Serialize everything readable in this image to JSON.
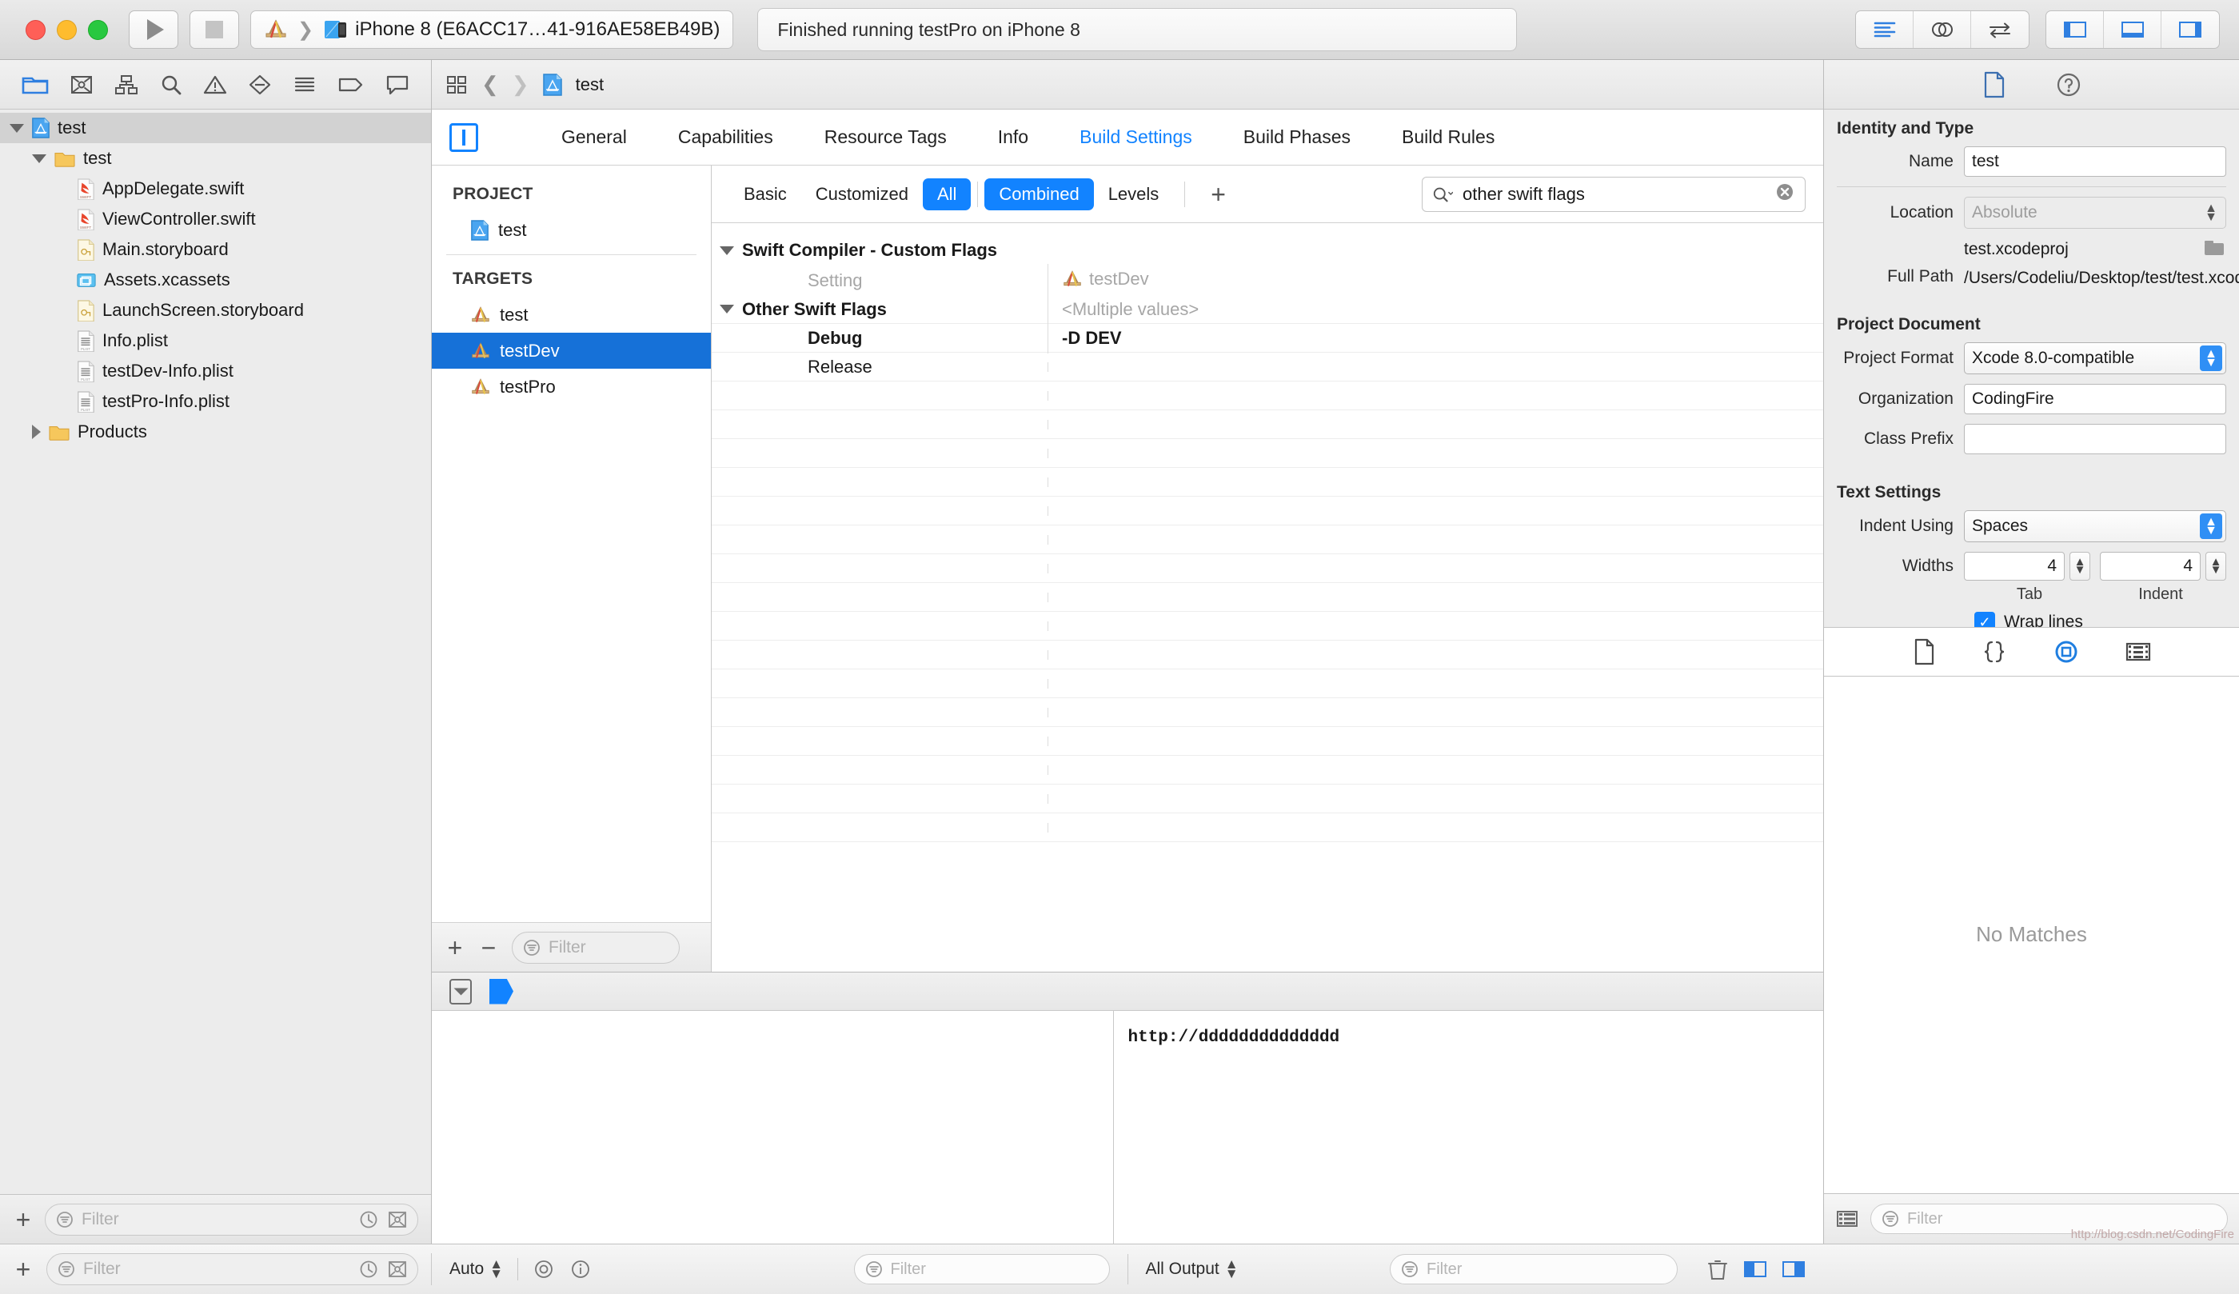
{
  "titlebar": {
    "scheme_target": "iPhone 8 (E6ACC17…41-916AE58EB49B)",
    "status": "Finished running testPro on iPhone 8",
    "run_icon": "play-icon",
    "stop_icon": "stop-icon"
  },
  "navigator": {
    "toolbar_icons": [
      "folder-icon",
      "source-control-icon",
      "symbol-icon",
      "search-icon",
      "warning-icon",
      "test-icon",
      "debug-icon",
      "breakpoint-icon",
      "report-icon"
    ],
    "tree": [
      {
        "label": "test",
        "depth": 0,
        "twisty": "down",
        "icon": "xcodeproj-icon",
        "selected": true
      },
      {
        "label": "test",
        "depth": 1,
        "twisty": "down",
        "icon": "folder-icon",
        "selected": false
      },
      {
        "label": "AppDelegate.swift",
        "depth": 2,
        "twisty": "none",
        "icon": "swift-icon",
        "selected": false
      },
      {
        "label": "ViewController.swift",
        "depth": 2,
        "twisty": "none",
        "icon": "swift-icon",
        "selected": false
      },
      {
        "label": "Main.storyboard",
        "depth": 2,
        "twisty": "none",
        "icon": "storyboard-icon",
        "selected": false
      },
      {
        "label": "Assets.xcassets",
        "depth": 2,
        "twisty": "none",
        "icon": "xcassets-icon",
        "selected": false
      },
      {
        "label": "LaunchScreen.storyboard",
        "depth": 2,
        "twisty": "none",
        "icon": "storyboard-icon",
        "selected": false
      },
      {
        "label": "Info.plist",
        "depth": 2,
        "twisty": "none",
        "icon": "plist-icon",
        "selected": false
      },
      {
        "label": "testDev-Info.plist",
        "depth": 2,
        "twisty": "none",
        "icon": "plist-icon",
        "selected": false
      },
      {
        "label": "testPro-Info.plist",
        "depth": 2,
        "twisty": "none",
        "icon": "plist-icon",
        "selected": false
      },
      {
        "label": "Products",
        "depth": 1,
        "twisty": "right",
        "icon": "folder-icon",
        "selected": false
      }
    ],
    "filter_placeholder": "Filter",
    "add_label": "+"
  },
  "jumpbar": {
    "title": "test"
  },
  "project_editor": {
    "tabs": [
      {
        "label": "General",
        "active": false
      },
      {
        "label": "Capabilities",
        "active": false
      },
      {
        "label": "Resource Tags",
        "active": false
      },
      {
        "label": "Info",
        "active": false
      },
      {
        "label": "Build Settings",
        "active": true
      },
      {
        "label": "Build Phases",
        "active": false
      },
      {
        "label": "Build Rules",
        "active": false
      }
    ],
    "project_header": "PROJECT",
    "project_items": [
      {
        "label": "test"
      }
    ],
    "targets_header": "TARGETS",
    "targets": [
      {
        "label": "test",
        "selected": false
      },
      {
        "label": "testDev",
        "selected": true
      },
      {
        "label": "testPro",
        "selected": false
      }
    ],
    "pane_add": "+",
    "pane_remove": "−",
    "pane_filter_placeholder": "Filter"
  },
  "build_settings": {
    "filters": [
      {
        "label": "Basic",
        "active": false
      },
      {
        "label": "Customized",
        "active": false
      },
      {
        "label": "All",
        "active": true
      },
      {
        "label": "Combined",
        "active": true
      },
      {
        "label": "Levels",
        "active": false
      }
    ],
    "add_label": "+",
    "search_value": "other swift flags",
    "search_icon": "search-icon",
    "clear_icon": "clear-icon",
    "group_title": "Swift Compiler - Custom Flags",
    "column_setting": "Setting",
    "column_target": "testDev",
    "rows": [
      {
        "name": "Other Swift Flags",
        "value": "<Multiple values>",
        "kind": "group",
        "bold": true,
        "value_muted": true
      },
      {
        "name": "Debug",
        "value": "-D DEV",
        "kind": "child",
        "bold": true,
        "value_muted": false
      },
      {
        "name": "Release",
        "value": "",
        "kind": "child",
        "bold": false,
        "value_muted": false
      }
    ],
    "empty_row_count": 16
  },
  "debug_area": {
    "console_text": "http://dddddddddddddd",
    "variables_text": ""
  },
  "bottom_bar": {
    "nav_add": "+",
    "nav_filter_placeholder": "Filter",
    "variables_scope": "Auto",
    "output_scope": "All Output",
    "debug_filter_placeholder": "Filter",
    "console_filter_placeholder": "Filter",
    "inspector_filter_placeholder": "Filter"
  },
  "inspector": {
    "tab_icons": [
      "file-inspector-icon",
      "quick-help-icon"
    ],
    "identity": {
      "title": "Identity and Type",
      "name_label": "Name",
      "name_value": "test",
      "location_label": "Location",
      "location_value": "Absolute",
      "filename_value": "test.xcodeproj",
      "fullpath_label": "Full Path",
      "fullpath_value": "/Users/Codeliu/Desktop/test/test.xcodeproj"
    },
    "document": {
      "title": "Project Document",
      "format_label": "Project Format",
      "format_value": "Xcode 8.0-compatible",
      "org_label": "Organization",
      "org_value": "CodingFire",
      "prefix_label": "Class Prefix",
      "prefix_value": ""
    },
    "text_settings": {
      "title": "Text Settings",
      "indent_label": "Indent Using",
      "indent_value": "Spaces",
      "widths_label": "Widths",
      "tab_value": "4",
      "indent_width_value": "4",
      "tab_sub": "Tab",
      "indent_sub": "Indent",
      "wrap_label": "Wrap lines",
      "wrap_checked": true
    },
    "library": {
      "tab_icons": [
        "file-template-icon",
        "code-snippet-icon",
        "object-library-icon",
        "media-library-icon"
      ],
      "empty_message": "No Matches"
    }
  },
  "watermark": "http://blog.csdn.net/CodingFire",
  "colors": {
    "accent": "#1283ff",
    "selection": "#1671d8",
    "muted": "#a6a6a6"
  }
}
